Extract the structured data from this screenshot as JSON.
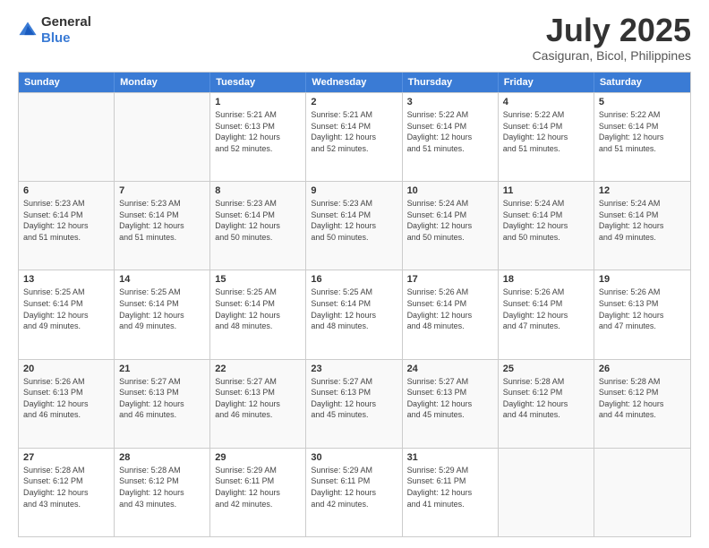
{
  "logo": {
    "line1": "General",
    "line2": "Blue"
  },
  "title": "July 2025",
  "location": "Casiguran, Bicol, Philippines",
  "header_days": [
    "Sunday",
    "Monday",
    "Tuesday",
    "Wednesday",
    "Thursday",
    "Friday",
    "Saturday"
  ],
  "weeks": [
    [
      {
        "day": "",
        "info": ""
      },
      {
        "day": "",
        "info": ""
      },
      {
        "day": "1",
        "info": "Sunrise: 5:21 AM\nSunset: 6:13 PM\nDaylight: 12 hours\nand 52 minutes."
      },
      {
        "day": "2",
        "info": "Sunrise: 5:21 AM\nSunset: 6:14 PM\nDaylight: 12 hours\nand 52 minutes."
      },
      {
        "day": "3",
        "info": "Sunrise: 5:22 AM\nSunset: 6:14 PM\nDaylight: 12 hours\nand 51 minutes."
      },
      {
        "day": "4",
        "info": "Sunrise: 5:22 AM\nSunset: 6:14 PM\nDaylight: 12 hours\nand 51 minutes."
      },
      {
        "day": "5",
        "info": "Sunrise: 5:22 AM\nSunset: 6:14 PM\nDaylight: 12 hours\nand 51 minutes."
      }
    ],
    [
      {
        "day": "6",
        "info": "Sunrise: 5:23 AM\nSunset: 6:14 PM\nDaylight: 12 hours\nand 51 minutes."
      },
      {
        "day": "7",
        "info": "Sunrise: 5:23 AM\nSunset: 6:14 PM\nDaylight: 12 hours\nand 51 minutes."
      },
      {
        "day": "8",
        "info": "Sunrise: 5:23 AM\nSunset: 6:14 PM\nDaylight: 12 hours\nand 50 minutes."
      },
      {
        "day": "9",
        "info": "Sunrise: 5:23 AM\nSunset: 6:14 PM\nDaylight: 12 hours\nand 50 minutes."
      },
      {
        "day": "10",
        "info": "Sunrise: 5:24 AM\nSunset: 6:14 PM\nDaylight: 12 hours\nand 50 minutes."
      },
      {
        "day": "11",
        "info": "Sunrise: 5:24 AM\nSunset: 6:14 PM\nDaylight: 12 hours\nand 50 minutes."
      },
      {
        "day": "12",
        "info": "Sunrise: 5:24 AM\nSunset: 6:14 PM\nDaylight: 12 hours\nand 49 minutes."
      }
    ],
    [
      {
        "day": "13",
        "info": "Sunrise: 5:25 AM\nSunset: 6:14 PM\nDaylight: 12 hours\nand 49 minutes."
      },
      {
        "day": "14",
        "info": "Sunrise: 5:25 AM\nSunset: 6:14 PM\nDaylight: 12 hours\nand 49 minutes."
      },
      {
        "day": "15",
        "info": "Sunrise: 5:25 AM\nSunset: 6:14 PM\nDaylight: 12 hours\nand 48 minutes."
      },
      {
        "day": "16",
        "info": "Sunrise: 5:25 AM\nSunset: 6:14 PM\nDaylight: 12 hours\nand 48 minutes."
      },
      {
        "day": "17",
        "info": "Sunrise: 5:26 AM\nSunset: 6:14 PM\nDaylight: 12 hours\nand 48 minutes."
      },
      {
        "day": "18",
        "info": "Sunrise: 5:26 AM\nSunset: 6:14 PM\nDaylight: 12 hours\nand 47 minutes."
      },
      {
        "day": "19",
        "info": "Sunrise: 5:26 AM\nSunset: 6:13 PM\nDaylight: 12 hours\nand 47 minutes."
      }
    ],
    [
      {
        "day": "20",
        "info": "Sunrise: 5:26 AM\nSunset: 6:13 PM\nDaylight: 12 hours\nand 46 minutes."
      },
      {
        "day": "21",
        "info": "Sunrise: 5:27 AM\nSunset: 6:13 PM\nDaylight: 12 hours\nand 46 minutes."
      },
      {
        "day": "22",
        "info": "Sunrise: 5:27 AM\nSunset: 6:13 PM\nDaylight: 12 hours\nand 46 minutes."
      },
      {
        "day": "23",
        "info": "Sunrise: 5:27 AM\nSunset: 6:13 PM\nDaylight: 12 hours\nand 45 minutes."
      },
      {
        "day": "24",
        "info": "Sunrise: 5:27 AM\nSunset: 6:13 PM\nDaylight: 12 hours\nand 45 minutes."
      },
      {
        "day": "25",
        "info": "Sunrise: 5:28 AM\nSunset: 6:12 PM\nDaylight: 12 hours\nand 44 minutes."
      },
      {
        "day": "26",
        "info": "Sunrise: 5:28 AM\nSunset: 6:12 PM\nDaylight: 12 hours\nand 44 minutes."
      }
    ],
    [
      {
        "day": "27",
        "info": "Sunrise: 5:28 AM\nSunset: 6:12 PM\nDaylight: 12 hours\nand 43 minutes."
      },
      {
        "day": "28",
        "info": "Sunrise: 5:28 AM\nSunset: 6:12 PM\nDaylight: 12 hours\nand 43 minutes."
      },
      {
        "day": "29",
        "info": "Sunrise: 5:29 AM\nSunset: 6:11 PM\nDaylight: 12 hours\nand 42 minutes."
      },
      {
        "day": "30",
        "info": "Sunrise: 5:29 AM\nSunset: 6:11 PM\nDaylight: 12 hours\nand 42 minutes."
      },
      {
        "day": "31",
        "info": "Sunrise: 5:29 AM\nSunset: 6:11 PM\nDaylight: 12 hours\nand 41 minutes."
      },
      {
        "day": "",
        "info": ""
      },
      {
        "day": "",
        "info": ""
      }
    ]
  ]
}
